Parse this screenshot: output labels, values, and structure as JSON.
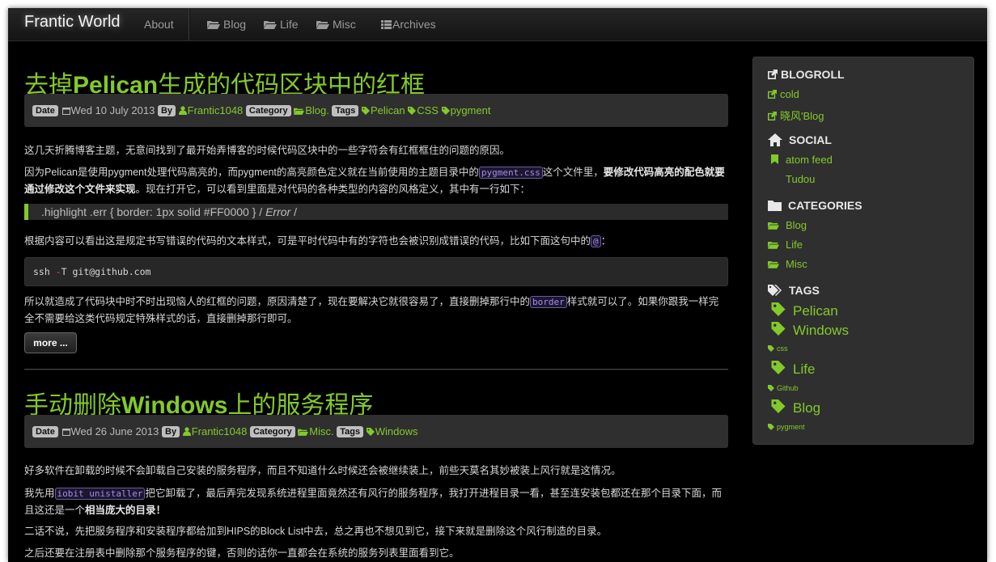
{
  "navbar": {
    "brand": "Frantic World",
    "about": "About",
    "blog": "Blog",
    "life": "Life",
    "misc": "Misc",
    "archives": "Archives"
  },
  "posts": [
    {
      "title_pre": "去掉",
      "title_bold": "Pelican",
      "title_post": "生成的代码区块中的红框",
      "date_label": "Date",
      "date": "Wed 10 July 2013",
      "by_label": "By",
      "author": "Frantic1048",
      "category_label": "Category",
      "category": "Blog.",
      "tags_label": "Tags",
      "tags": [
        "Pelican",
        "CSS",
        "pygment"
      ],
      "p1": "这几天折腾博客主题，无意间找到了最开始弄博客的时候代码区块中的一些字符会有红框框住的问题的原因。",
      "p2_a": "因为Pelican是使用pygment处理代码高亮的，而pygment的高亮颜色定义就在当前使用的主题目录中的",
      "p2_code": "pygment.css",
      "p2_b": "这个文件里，",
      "p2_bold": "要修改代码高亮的配色就要通过修改这个文件来实现",
      "p2_c": "。现在打开它，可以看到里面是对代码的各种类型的内容的风格定义，其中有一行如下：",
      "quote_text": ".highlight .err { border: 1px solid #FF0000 } /",
      "quote_em": "Error",
      "quote_end": "/",
      "p3_a": "根据内容可以看出这是规定书写错误的代码的文本样式，可是平时代码中有的字符也会被识别成错误的代码，比如下面这句中的",
      "p3_code": "@",
      "p3_b": "：",
      "code_a": "ssh ",
      "code_op": "-",
      "code_b": "T git@github.com",
      "p4_a": "所以就造成了代码块中时不时出现恼人的红框的问题，原因清楚了，现在要解决它就很容易了，直接删掉那行中的",
      "p4_code": "border",
      "p4_b": "样式就可以了。如果你跟我一样完全不需要给这类代码规定特殊样式的话，直接删掉那行即可。",
      "more": "more ..."
    },
    {
      "title_pre": "手动删除",
      "title_bold": "Windows",
      "title_post": "上的服务程序",
      "date_label": "Date",
      "date": "Wed 26 June 2013",
      "by_label": "By",
      "author": "Frantic1048",
      "category_label": "Category",
      "category": "Misc.",
      "tags_label": "Tags",
      "tags": [
        "Windows"
      ],
      "p1": "好多软件在卸载的时候不会卸载自己安装的服务程序，而且不知道什么时候还会被继续装上，前些天莫名其妙被装上风行就是这情况。",
      "p2_a": "我先用",
      "p2_code": "iobit unistaller",
      "p2_b": "把它卸载了，最后弄完发现系统进程里面竟然还有风行的服务程序，我打开进程目录一看，甚至连安装包都还在那个目录下面，而且这还是一个",
      "p2_bold": "相当庞大的目录！",
      "p3": "二话不说，先把服务程序和安装程序都给加到HIPS的Block List中去，总之再也不想见到它，接下来就是删除这个风行制造的目录。",
      "p4": "之后还要在注册表中删除那个服务程序的键，否则的话你一直都会在系统的服务列表里面看到它。"
    }
  ],
  "sidebar": {
    "blogroll_title": "BLOGROLL",
    "blogroll": [
      "cold",
      "晓风'Blog"
    ],
    "social_title": "SOCIAL",
    "social": [
      "atom feed",
      "Tudou"
    ],
    "categories_title": "CATEGORIES",
    "categories": [
      "Blog",
      "Life",
      "Misc"
    ],
    "tags_title": "TAGS",
    "tags": [
      {
        "name": "Pelican",
        "size": "big"
      },
      {
        "name": "Windows",
        "size": "big"
      },
      {
        "name": "css",
        "size": "small"
      },
      {
        "name": "Life",
        "size": "big"
      },
      {
        "name": "Github",
        "size": "small"
      },
      {
        "name": "Blog",
        "size": "big"
      },
      {
        "name": "pygment",
        "size": "small"
      }
    ]
  },
  "colors": {
    "accent": "#83c92b",
    "background": "#000000",
    "panel": "#2f2f2f"
  },
  "icons": [
    "folder-icon",
    "list-icon",
    "calendar-icon",
    "user-icon",
    "tag-icon",
    "external-link-icon",
    "home-icon",
    "bookmark-icon"
  ]
}
